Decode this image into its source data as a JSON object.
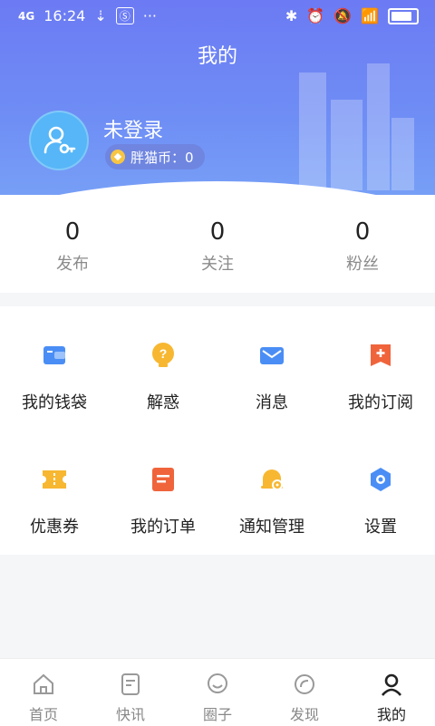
{
  "status_bar": {
    "network": "4G",
    "time": "16:24",
    "usb_icon": "usb-icon",
    "more": "···"
  },
  "header": {
    "title": "我的"
  },
  "profile": {
    "username": "未登录",
    "coin_label": "胖猫币：0"
  },
  "stats": [
    {
      "value": "0",
      "label": "发布"
    },
    {
      "value": "0",
      "label": "关注"
    },
    {
      "value": "0",
      "label": "粉丝"
    }
  ],
  "menu": [
    {
      "label": "我的钱袋",
      "icon": "wallet-icon"
    },
    {
      "label": "解惑",
      "icon": "question-icon"
    },
    {
      "label": "消息",
      "icon": "mail-icon"
    },
    {
      "label": "我的订阅",
      "icon": "subscription-icon"
    },
    {
      "label": "优惠券",
      "icon": "coupon-icon"
    },
    {
      "label": "我的订单",
      "icon": "order-icon"
    },
    {
      "label": "通知管理",
      "icon": "notification-settings-icon"
    },
    {
      "label": "设置",
      "icon": "settings-icon"
    }
  ],
  "tabbar": [
    {
      "label": "首页",
      "icon": "home-icon"
    },
    {
      "label": "快讯",
      "icon": "news-icon"
    },
    {
      "label": "圈子",
      "icon": "community-icon"
    },
    {
      "label": "发现",
      "icon": "discover-icon"
    },
    {
      "label": "我的",
      "icon": "profile-icon",
      "active": true
    }
  ],
  "colors": {
    "header_gradient_top": "#6c7af3",
    "header_gradient_bottom": "#79a4f7",
    "avatar_bg": "#56b6f7",
    "coin_icon": "#f7c543"
  }
}
